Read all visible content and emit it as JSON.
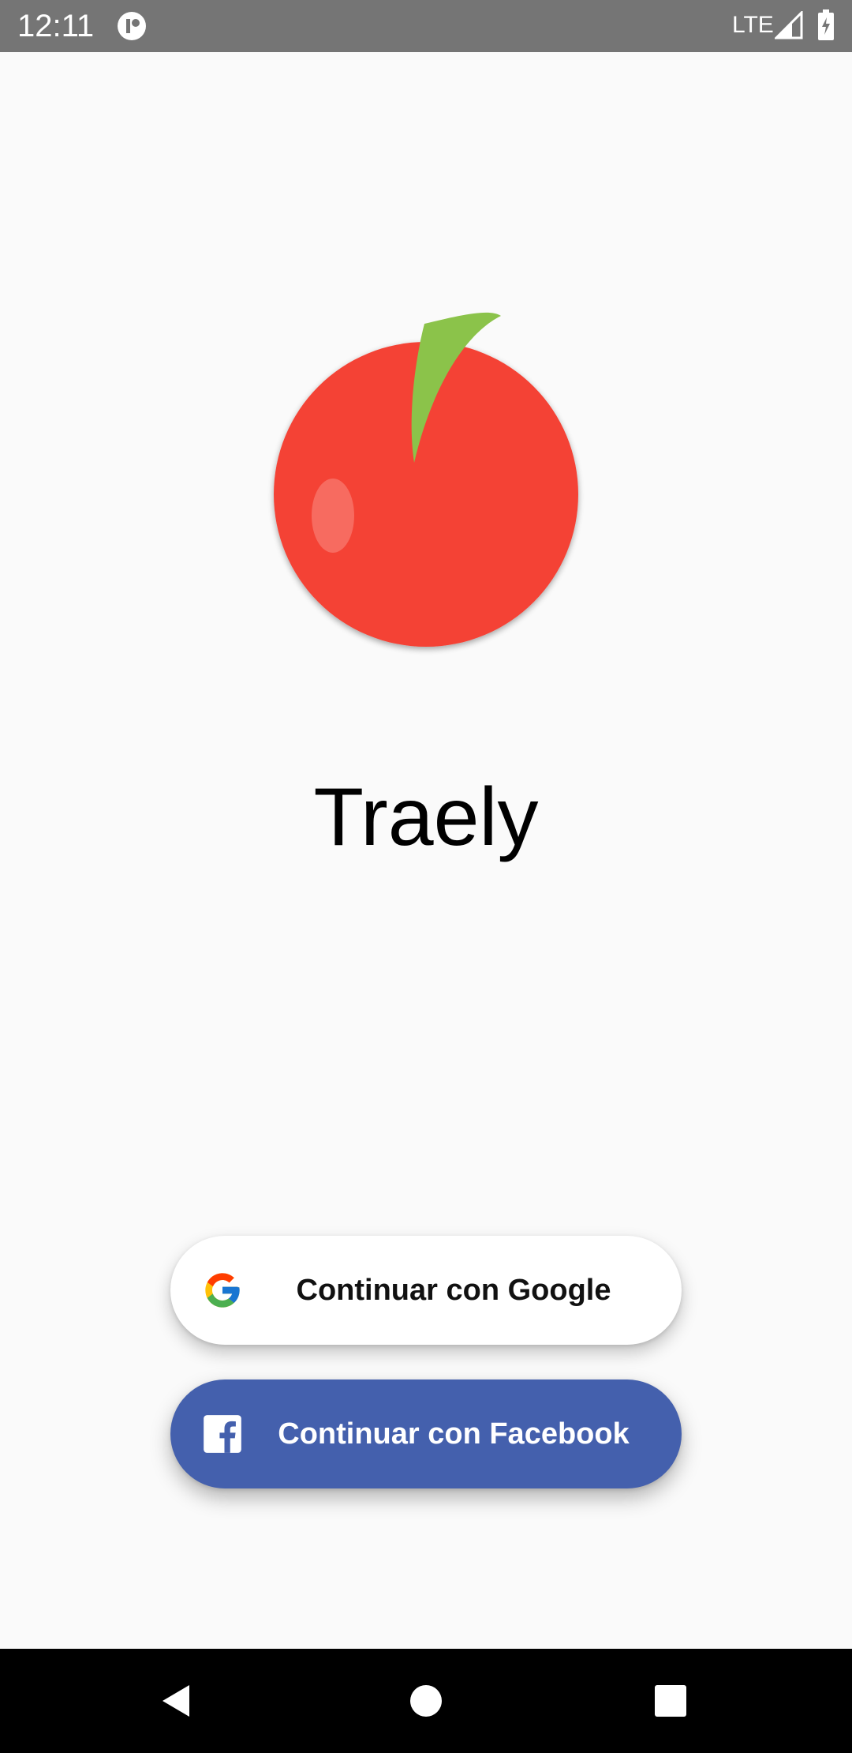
{
  "status_bar": {
    "time": "12:11",
    "network": "LTE",
    "icons": [
      "app-notification-icon",
      "signal-icon",
      "battery-charging-icon"
    ]
  },
  "app": {
    "title": "Traely",
    "logo_icon": "apple-logo-icon"
  },
  "buttons": {
    "google": {
      "label": "Continuar con Google",
      "icon": "google-icon"
    },
    "facebook": {
      "label": "Continuar con Facebook",
      "icon": "facebook-icon"
    }
  },
  "nav_bar": {
    "icons": [
      "back-icon",
      "home-icon",
      "recents-icon"
    ]
  },
  "colors": {
    "background": "#fafafa",
    "status_bar": "#757575",
    "apple_red": "#f44336",
    "leaf_green": "#8bc34a",
    "facebook_blue": "#4460ad",
    "nav_bar": "#000000"
  }
}
